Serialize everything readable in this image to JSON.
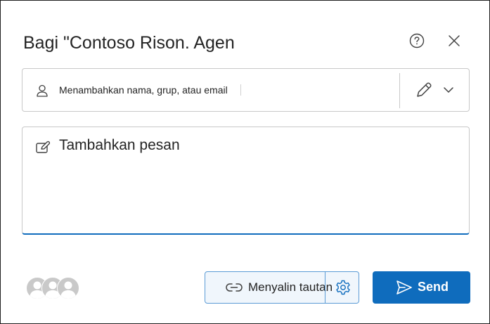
{
  "dialog": {
    "title": "Bagi \"Contoso Rison. Agen",
    "help_icon": "help-circle-icon",
    "close_icon": "close-icon"
  },
  "recipients": {
    "placeholder": "Menambahkan nama, grup, atau email",
    "person_icon": "person-icon",
    "permission_icon": "pencil-icon",
    "dropdown_icon": "chevron-down-icon"
  },
  "message": {
    "placeholder": "Tambahkan pesan",
    "compose_icon": "compose-icon"
  },
  "footer": {
    "avatar_count": 3,
    "copy_link_label": "Menyalin tautan",
    "link_icon": "link-icon",
    "settings_icon": "gear-icon",
    "send_label": "Send",
    "send_icon": "send-icon"
  },
  "colors": {
    "accent": "#0f6cbd",
    "copy_link_border": "#5b9bd5",
    "copy_link_background": "#f0f6fc",
    "border": "#c8c8c8",
    "text": "#242424"
  }
}
